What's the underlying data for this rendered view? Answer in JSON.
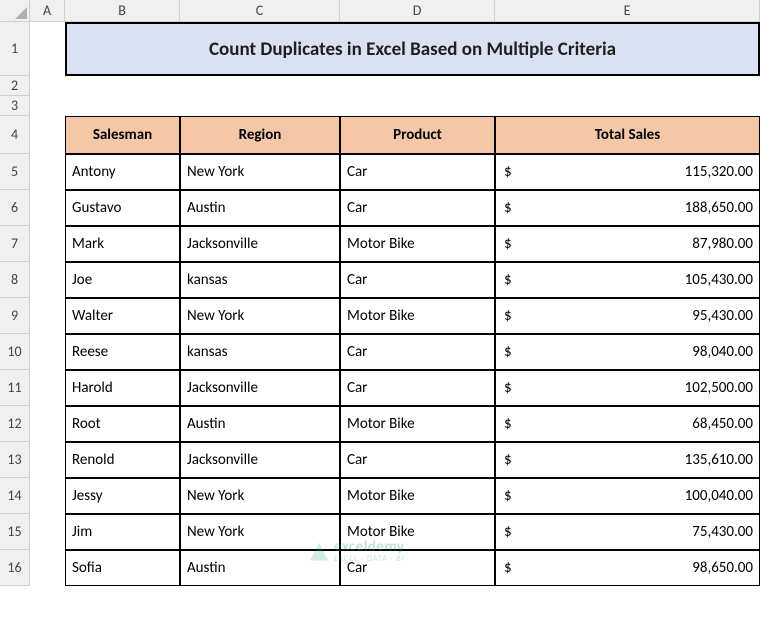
{
  "columns": [
    "A",
    "B",
    "C",
    "D",
    "E"
  ],
  "row_labels": [
    "1",
    "2",
    "3",
    "4",
    "5",
    "6",
    "7",
    "8",
    "9",
    "10",
    "11",
    "12",
    "13",
    "14",
    "15",
    "16"
  ],
  "title": "Count Duplicates in Excel Based on Multiple Criteria",
  "headers": {
    "salesman": "Salesman",
    "region": "Region",
    "product": "Product",
    "total_sales": "Total Sales"
  },
  "currency_symbol": "$",
  "chart_data": {
    "type": "table",
    "columns": [
      "Salesman",
      "Region",
      "Product",
      "Total Sales"
    ],
    "rows": [
      {
        "salesman": "Antony",
        "region": "New York",
        "product": "Car",
        "total_sales": "115,320.00"
      },
      {
        "salesman": "Gustavo",
        "region": "Austin",
        "product": "Car",
        "total_sales": "188,650.00"
      },
      {
        "salesman": "Mark",
        "region": "Jacksonville",
        "product": "Motor Bike",
        "total_sales": "87,980.00"
      },
      {
        "salesman": "Joe",
        "region": "kansas",
        "product": "Car",
        "total_sales": "105,430.00"
      },
      {
        "salesman": "Walter",
        "region": "New York",
        "product": "Motor Bike",
        "total_sales": "95,430.00"
      },
      {
        "salesman": "Reese",
        "region": "kansas",
        "product": "Car",
        "total_sales": "98,040.00"
      },
      {
        "salesman": "Harold",
        "region": "Jacksonville",
        "product": "Car",
        "total_sales": "102,500.00"
      },
      {
        "salesman": "Root",
        "region": "Austin",
        "product": "Motor Bike",
        "total_sales": "68,450.00"
      },
      {
        "salesman": "Renold",
        "region": "Jacksonville",
        "product": "Car",
        "total_sales": "135,610.00"
      },
      {
        "salesman": "Jessy",
        "region": "New York",
        "product": "Motor Bike",
        "total_sales": "100,040.00"
      },
      {
        "salesman": "Jim",
        "region": "New York",
        "product": "Motor Bike",
        "total_sales": "75,430.00"
      },
      {
        "salesman": "Sofia",
        "region": "Austin",
        "product": "Car",
        "total_sales": "98,650.00"
      }
    ]
  },
  "watermark": {
    "name": "exceldemy",
    "tagline": "EXCEL · DATA · BI"
  }
}
